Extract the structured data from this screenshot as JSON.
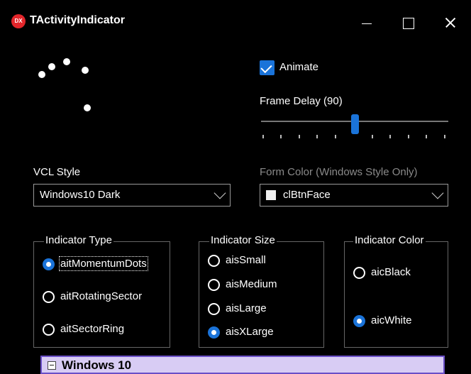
{
  "window": {
    "title": "TActivityIndicator",
    "app_icon_text": "DX"
  },
  "animate": {
    "label": "Animate",
    "checked": true
  },
  "frame_delay": {
    "label": "Frame Delay (90)",
    "value": 90
  },
  "vcl_style": {
    "label": "VCL Style",
    "value": "Windows10 Dark"
  },
  "form_color": {
    "label": "Form Color (Windows Style Only)",
    "value": "clBtnFace"
  },
  "indicator_type": {
    "title": "Indicator Type",
    "options": [
      "aitMomentumDots",
      "aitRotatingSector",
      "aitSectorRing"
    ],
    "selected": "aitMomentumDots"
  },
  "indicator_size": {
    "title": "Indicator Size",
    "options": [
      "aisSmall",
      "aisMedium",
      "aisLarge",
      "aisXLarge"
    ],
    "selected": "aisXLarge"
  },
  "indicator_color": {
    "title": "Indicator Color",
    "options": [
      "aicBlack",
      "aicWhite"
    ],
    "selected": "aicWhite"
  },
  "bottom_panel": {
    "label": "Windows 10"
  },
  "colors": {
    "accent": "#1a73d9",
    "background": "#000000",
    "panel": "#d8ccf4"
  }
}
